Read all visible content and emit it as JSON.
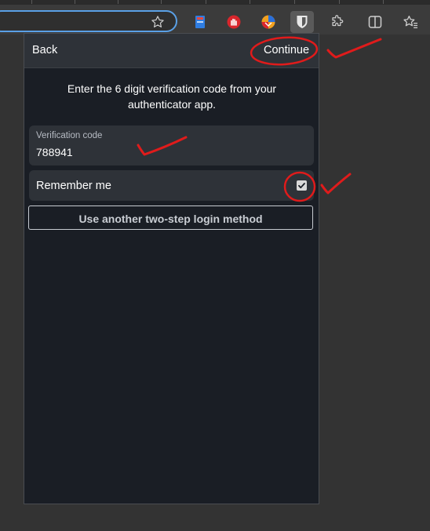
{
  "popup": {
    "header": {
      "back_label": "Back",
      "continue_label": "Continue"
    },
    "instructions": "Enter the 6 digit verification code from your authenticator app.",
    "verification_field": {
      "label": "Verification code",
      "value": "788941"
    },
    "remember_me": {
      "label": "Remember me",
      "checked": true
    },
    "another_method_label": "Use another two-step login method"
  },
  "toolbar": {
    "icons": [
      "star-icon",
      "bookmark-extension-icon",
      "hand-extension-icon",
      "colorful-extension-icon",
      "bitwarden-shield-icon",
      "puzzle-extensions-icon",
      "split-screen-icon",
      "favorites-icon"
    ]
  },
  "colors": {
    "accent_red": "#e01b1b",
    "popup_bg": "#1a1e25",
    "panel_bg": "#2e3238"
  }
}
